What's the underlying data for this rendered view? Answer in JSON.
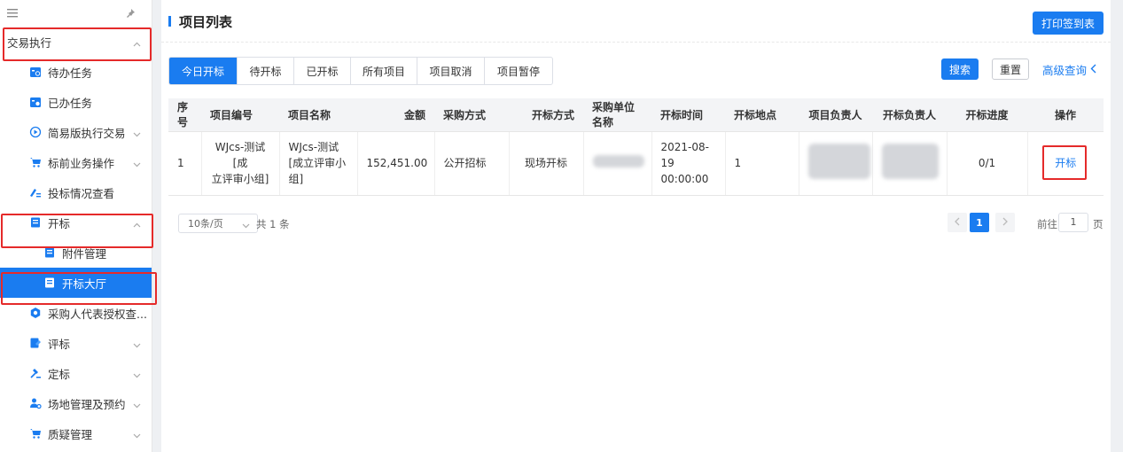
{
  "sidebar": {
    "group_label": "交易执行",
    "items": [
      {
        "label": "待办任务",
        "icon": "todo-icon"
      },
      {
        "label": "已办任务",
        "icon": "done-icon"
      },
      {
        "label": "简易版执行交易",
        "icon": "play-circle-icon"
      },
      {
        "label": "标前业务操作",
        "icon": "cart-icon"
      },
      {
        "label": "投标情况查看",
        "icon": "edit-list-icon"
      },
      {
        "label": "开标",
        "icon": "document-icon"
      },
      {
        "label": "附件管理",
        "icon": "document-icon"
      },
      {
        "label": "开标大厅",
        "icon": "document-icon"
      },
      {
        "label": "采购人代表授权查...",
        "icon": "gear-icon"
      },
      {
        "label": "评标",
        "icon": "review-icon"
      },
      {
        "label": "定标",
        "icon": "gavel-icon"
      },
      {
        "label": "场地管理及预约",
        "icon": "user-settings-icon"
      },
      {
        "label": "质疑管理",
        "icon": "cart-icon"
      }
    ]
  },
  "header": {
    "title": "项目列表",
    "print_button": "打印签到表"
  },
  "tabs": [
    "今日开标",
    "待开标",
    "已开标",
    "所有项目",
    "项目取消",
    "项目暂停"
  ],
  "toolbar": {
    "search": "搜索",
    "reset": "重置",
    "advanced": "高级查询"
  },
  "table": {
    "columns": [
      "序号",
      "项目编号",
      "项目名称",
      "金额",
      "采购方式",
      "开标方式",
      "采购单位名称",
      "开标时间",
      "开标地点",
      "项目负责人",
      "开标负责人",
      "开标进度",
      "操作"
    ],
    "rows": [
      {
        "index": "1",
        "code_line1": "WJcs-测试[成",
        "code_line2": "立评审小组]",
        "name_line1": "WJcs-测试",
        "name_line2": "[成立评审小",
        "name_line3": "组]",
        "amount": "152,451.00",
        "purchase_method": "公开招标",
        "open_method": "现场开标",
        "open_date": "2021-08-19",
        "open_time": "00:00:00",
        "location": "1",
        "progress": "0/1",
        "action": "开标"
      }
    ]
  },
  "pagination": {
    "page_size": "10条/页",
    "total": "共 1 条",
    "current_page": "1",
    "goto_label": "前往",
    "goto_value": "1",
    "page_unit": "页"
  },
  "colors": {
    "primary": "#1a7cf0",
    "highlight": "#e52a2a"
  }
}
